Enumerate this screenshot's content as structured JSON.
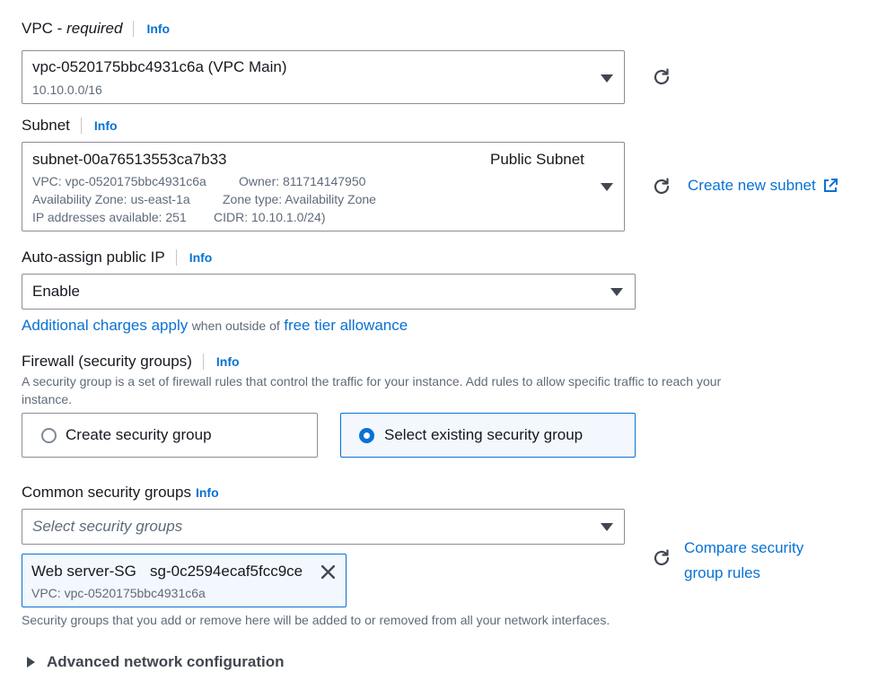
{
  "vpc": {
    "label": "VPC - ",
    "required": "required",
    "info": "Info",
    "value": "vpc-0520175bbc4931c6a (VPC Main)",
    "cidr": "10.10.0.0/16"
  },
  "subnet": {
    "label": "Subnet",
    "info": "Info",
    "value": "subnet-00a76513553ca7b33",
    "name": "Public Subnet",
    "line1a": "VPC: vpc-0520175bbc4931c6a",
    "line1b": "Owner: 811714147950",
    "line2a": "Availability Zone: us-east-1a",
    "line2b": "Zone type: Availability Zone",
    "line3a": "IP addresses available: 251",
    "line3b": "CIDR: 10.10.1.0/24)",
    "create_link": "Create new subnet"
  },
  "public_ip": {
    "label": "Auto-assign public IP",
    "info": "Info",
    "value": "Enable",
    "charges_link": "Additional charges apply",
    "charges_text": "when outside of",
    "free_tier_link": "free tier allowance"
  },
  "firewall": {
    "label": "Firewall (security groups)",
    "info": "Info",
    "description_line1": "A security group is a set of firewall rules that control the traffic for your instance. Add rules to allow specific traffic to reach your",
    "description_line2": "instance.",
    "option_create": "Create security group",
    "option_select": "Select existing security group",
    "selected": "Select existing security group"
  },
  "common_sg": {
    "label": "Common security groups",
    "info": "Info",
    "placeholder": "Select security groups",
    "compare_line1": "Compare security",
    "compare_line2": "group rules",
    "token": {
      "name": "Web server-SG",
      "id": "sg-0c2594ecaf5fcc9ce",
      "vpc": "VPC: vpc-0520175bbc4931c6a"
    },
    "note": "Security groups that you add or remove here will be added to or removed from all your network interfaces."
  },
  "advanced": {
    "label": "Advanced network configuration"
  },
  "colors": {
    "link": "#0972d3",
    "text": "#16191f",
    "secondary": "#5f6b7a",
    "selected_bg": "#f2f8fd"
  },
  "icons": [
    "refresh-icon",
    "external-link-icon",
    "caret-down-icon",
    "close-icon",
    "caret-right-icon"
  ]
}
